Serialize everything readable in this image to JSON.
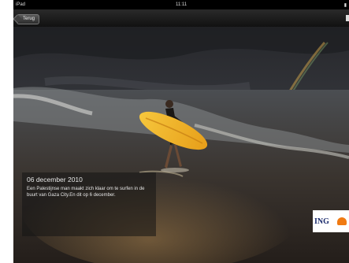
{
  "statusbar": {
    "device": "iPad",
    "time": "11:11",
    "battery": "65%"
  },
  "navbar": {
    "back_label": "Terug"
  },
  "caption": {
    "date": "06 december 2010",
    "text": "Een Palestijnse man maakt zich klaar om te surfen in de buurt van Gaza City.En dit op 6 december."
  },
  "ad": {
    "brand": "ING"
  },
  "colors": {
    "surfboard": "#f2b623",
    "sky_dark": "#2f3033",
    "sea": "#4a4039"
  }
}
